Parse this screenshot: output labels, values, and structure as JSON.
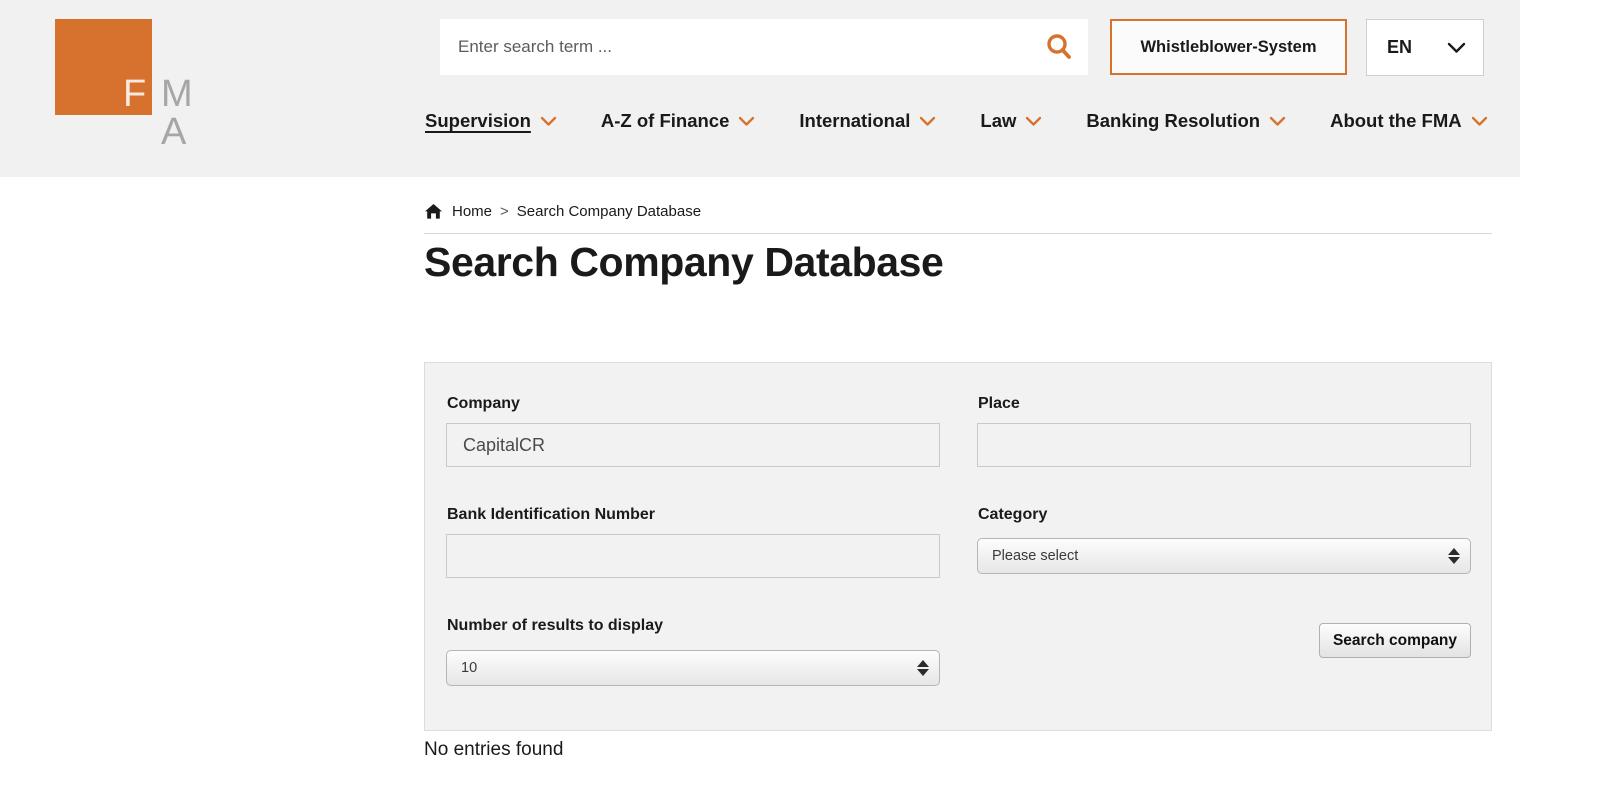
{
  "header": {
    "logo": {
      "square_letter": "F",
      "rest_letters": "M A",
      "accent_color": "#d6722d"
    },
    "search": {
      "placeholder": "Enter search term ...",
      "value": "",
      "icon": "search-icon"
    },
    "whistleblower_label": "Whistleblower-System",
    "language": {
      "selected": "EN",
      "icon": "chevron-down-icon"
    },
    "nav": [
      {
        "label": "Supervision",
        "active": true,
        "icon": "chevron-down-icon"
      },
      {
        "label": "A-Z of Finance",
        "active": false,
        "icon": "chevron-down-icon"
      },
      {
        "label": "International",
        "active": false,
        "icon": "chevron-down-icon"
      },
      {
        "label": "Law",
        "active": false,
        "icon": "chevron-down-icon"
      },
      {
        "label": "Banking Resolution",
        "active": false,
        "icon": "chevron-down-icon"
      },
      {
        "label": "About the FMA",
        "active": false,
        "icon": "chevron-down-icon"
      }
    ]
  },
  "breadcrumb": {
    "home_icon": "home-icon",
    "home": "Home",
    "separator": ">",
    "current": "Search Company Database"
  },
  "page_title": "Search Company Database",
  "form": {
    "company": {
      "label": "Company",
      "value": "CapitalCR",
      "placeholder": ""
    },
    "place": {
      "label": "Place",
      "value": "",
      "placeholder": ""
    },
    "bank_id": {
      "label": "Bank Identification Number",
      "value": "",
      "placeholder": ""
    },
    "category": {
      "label": "Category",
      "selected": "Please select"
    },
    "results_count": {
      "label": "Number of results to display",
      "selected": "10"
    },
    "submit_label": "Search company"
  },
  "results": {
    "empty_message": "No entries found"
  }
}
